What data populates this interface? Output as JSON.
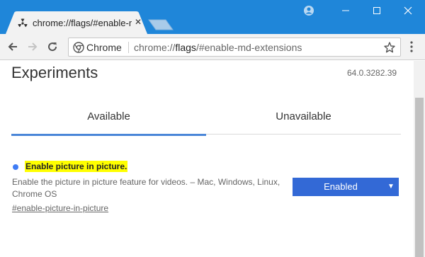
{
  "tab": {
    "title": "chrome://flags/#enable-md-extensions",
    "favicon": "radiation-icon"
  },
  "toolbar": {
    "origin_label": "Chrome",
    "url_host": "chrome://",
    "url_path_strong": "flags",
    "url_rest": "/#enable-md-extensions"
  },
  "page": {
    "title": "Experiments",
    "version": "64.0.3282.39",
    "tabs": [
      {
        "label": "Available",
        "selected": true
      },
      {
        "label": "Unavailable",
        "selected": false
      }
    ]
  },
  "flag": {
    "name": "Enable picture in picture.",
    "description": "Enable the picture in picture feature for videos. – Mac, Windows, Linux, Chrome OS",
    "link": "#enable-picture-in-picture",
    "selected_value": "Enabled"
  },
  "colors": {
    "titlebar": "#1f86d9",
    "accent": "#4a86d8",
    "select_bg": "#3369d6",
    "highlight": "#ffff00"
  }
}
